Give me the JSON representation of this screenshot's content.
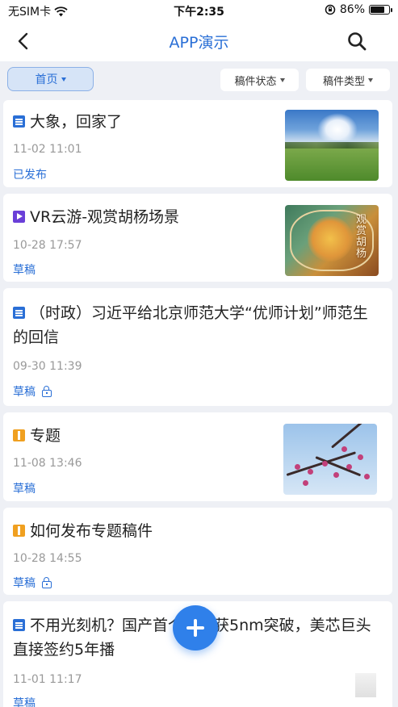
{
  "status_bar": {
    "carrier": "无SIM卡",
    "time": "下午2:35",
    "battery": "86%",
    "battery_level": 0.86
  },
  "nav": {
    "title": "APP演示"
  },
  "filters": {
    "home": "首页",
    "status": "稿件状态",
    "type": "稿件类型"
  },
  "articles": [
    {
      "type": "doc",
      "title": "大象，回家了",
      "date": "11-02 11:01",
      "status": "已发布",
      "locked": false,
      "thumb": "field"
    },
    {
      "type": "video",
      "title": "VR云游-观赏胡杨场景",
      "date": "10-28 17:57",
      "status": "草稿",
      "locked": false,
      "thumb": "poplar",
      "thumb_text": "观赏胡杨"
    },
    {
      "type": "doc",
      "title": "（时政）习近平给北京师范大学“优师计划”师范生的回信",
      "date": "09-30 11:39",
      "status": "草稿",
      "locked": true
    },
    {
      "type": "topic",
      "title": "专题",
      "date": "11-08 13:46",
      "status": "草稿",
      "locked": false,
      "thumb": "blossom"
    },
    {
      "type": "topic",
      "title": "如何发布专题稿件",
      "date": "10-28 14:55",
      "status": "草稿",
      "locked": true
    },
    {
      "type": "doc",
      "title": "不用光刻机？国产首个技术获5nm突破，美芯巨头直接签约5年播",
      "date": "11-01 11:17",
      "status": "草稿",
      "locked": false
    }
  ],
  "colors": {
    "accent": "#2a6fd6",
    "video": "#6a3fd8",
    "topic": "#f0a020",
    "fab": "#2f80ea"
  },
  "icons": [
    "back-arrow-icon",
    "search-icon",
    "wifi-icon",
    "battery-icon",
    "orientation-lock-icon",
    "document-icon",
    "video-icon",
    "topic-icon",
    "lock-icon",
    "plus-icon"
  ]
}
